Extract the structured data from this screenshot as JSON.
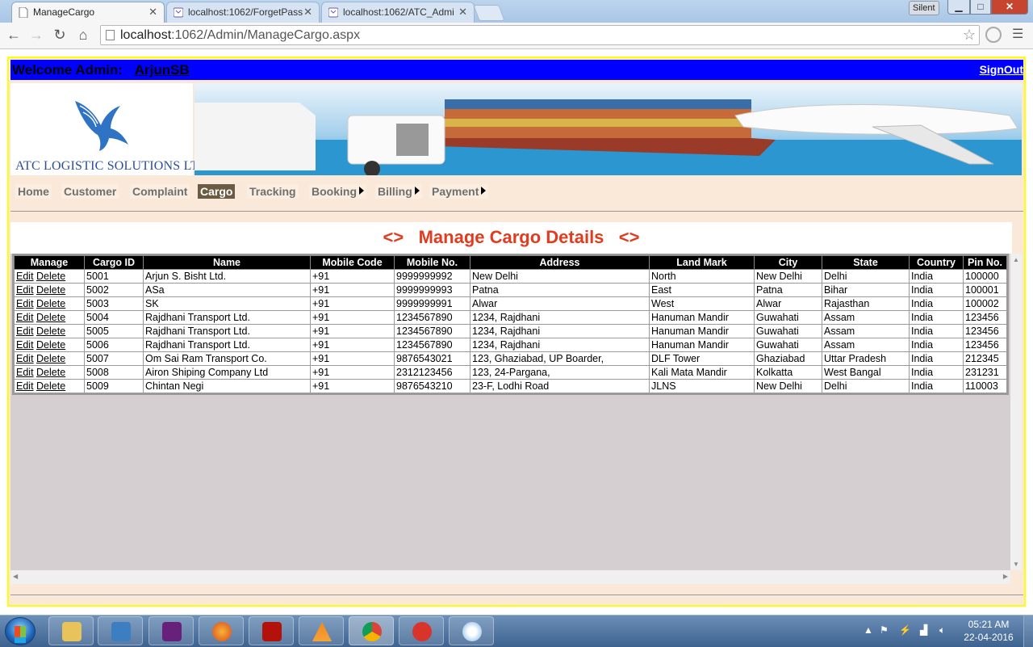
{
  "browser": {
    "tabs": [
      {
        "title": "ManageCargo",
        "active": true
      },
      {
        "title": "localhost:1062/ForgetPass",
        "active": false
      },
      {
        "title": "localhost:1062/ATC_Admi",
        "active": false
      }
    ],
    "close_glyph": "✕",
    "silent_label": "Silent",
    "url_host": "localhost",
    "url_rest": ":1062/Admin/ManageCargo.aspx"
  },
  "header": {
    "welcome_label": "Welcome Admin:",
    "username": "ArjunSB",
    "signout": "SignOut"
  },
  "logo": {
    "company": "ATC LOGISTIC SOLUTIONS LTD.,"
  },
  "menu": [
    {
      "label": "Home"
    },
    {
      "label": "Customer"
    },
    {
      "label": "Complaint"
    },
    {
      "label": "Cargo",
      "selected": true
    },
    {
      "label": "Tracking"
    },
    {
      "label": "Booking",
      "submenu": true
    },
    {
      "label": "Billing",
      "submenu": true
    },
    {
      "label": "Payment",
      "submenu": true
    }
  ],
  "main": {
    "heading": "<>   Manage Cargo Details   <>"
  },
  "table": {
    "columns": [
      "Manage",
      "Cargo ID",
      "Name",
      "Mobile Code",
      "Mobile No.",
      "Address",
      "Land Mark",
      "City",
      "State",
      "Country",
      "Pin No."
    ],
    "edit_label": "Edit",
    "delete_label": "Delete",
    "rows": [
      {
        "id": "5001",
        "name": "Arjun S. Bisht Ltd.",
        "code": "+91",
        "mobile": "9999999992",
        "address": "New Delhi",
        "landmark": "North",
        "city": "New Delhi",
        "state": "Delhi",
        "country": "India",
        "pin": "100000"
      },
      {
        "id": "5002",
        "name": "ASa",
        "code": "+91",
        "mobile": "9999999993",
        "address": "Patna",
        "landmark": "East",
        "city": "Patna",
        "state": "Bihar",
        "country": "India",
        "pin": "100001"
      },
      {
        "id": "5003",
        "name": "SK",
        "code": "+91",
        "mobile": "9999999991",
        "address": "Alwar",
        "landmark": "West",
        "city": "Alwar",
        "state": "Rajasthan",
        "country": "India",
        "pin": "100002"
      },
      {
        "id": "5004",
        "name": "Rajdhani Transport Ltd.",
        "code": "+91",
        "mobile": "1234567890",
        "address": "1234, Rajdhani",
        "landmark": "Hanuman Mandir",
        "city": "Guwahati",
        "state": "Assam",
        "country": "India",
        "pin": "123456"
      },
      {
        "id": "5005",
        "name": "Rajdhani Transport Ltd.",
        "code": "+91",
        "mobile": "1234567890",
        "address": "1234, Rajdhani",
        "landmark": "Hanuman Mandir",
        "city": "Guwahati",
        "state": "Assam",
        "country": "India",
        "pin": "123456"
      },
      {
        "id": "5006",
        "name": "Rajdhani Transport Ltd.",
        "code": "+91",
        "mobile": "1234567890",
        "address": "1234, Rajdhani",
        "landmark": "Hanuman Mandir",
        "city": "Guwahati",
        "state": "Assam",
        "country": "India",
        "pin": "123456"
      },
      {
        "id": "5007",
        "name": "Om Sai Ram Transport Co.",
        "code": "+91",
        "mobile": "9876543021",
        "address": "123, Ghaziabad, UP Boarder,",
        "landmark": "DLF Tower",
        "city": "Ghaziabad",
        "state": "Uttar Pradesh",
        "country": "India",
        "pin": "212345"
      },
      {
        "id": "5008",
        "name": "Airon Shiping Company Ltd",
        "code": "+91",
        "mobile": "2312123456",
        "address": "123, 24-Pargana,",
        "landmark": "Kali Mata Mandir",
        "city": "Kolkatta",
        "state": "West Bangal",
        "country": "India",
        "pin": "231231"
      },
      {
        "id": "5009",
        "name": "Chintan Negi",
        "code": "+91",
        "mobile": "9876543210",
        "address": "23-F, Lodhi Road",
        "landmark": "JLNS",
        "city": "New Delhi",
        "state": "Delhi",
        "country": "India",
        "pin": "110003"
      }
    ]
  },
  "taskbar": {
    "apps": [
      "file-explorer",
      "media-player",
      "visual-studio",
      "firefox",
      "acrobat-reader",
      "vlc",
      "chrome",
      "ccleaner",
      "paint"
    ],
    "time": "05:21 AM",
    "date": "22-04-2016"
  },
  "colors": {
    "topbar": "#0000ff",
    "heading": "#e23b1e",
    "page_bg": "#fae9d8",
    "page_border": "#ffff00",
    "menu_selected": "#6b5b42"
  }
}
